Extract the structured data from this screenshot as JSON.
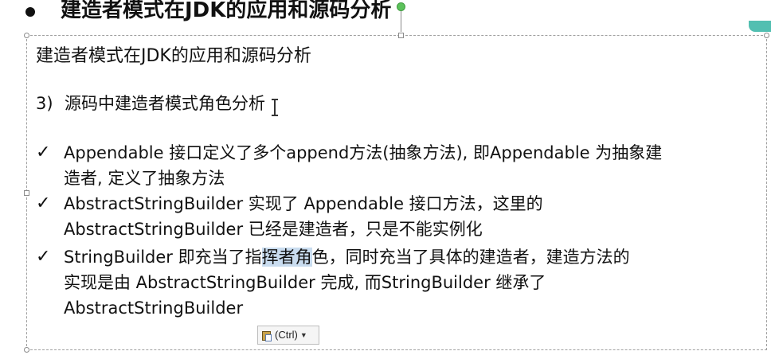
{
  "slide": {
    "title": "建造者模式在JDK的应用和源码分析"
  },
  "textbox": {
    "title": "建造者模式在JDK的应用和源码分析",
    "section_number": "3)",
    "section_title": "源码中建造者模式角色分析",
    "items": [
      {
        "lines": [
          "Appendable 接口定义了多个append方法(抽象方法), 即Appendable 为抽象建",
          "造者, 定义了抽象方法"
        ]
      },
      {
        "lines": [
          "AbstractStringBuilder 实现了 Appendable 接口方法，这里的",
          "AbstractStringBuilder  已经是建造者，只是不能实例化"
        ]
      },
      {
        "line1_before": "StringBuilder 即充当了指",
        "line1_selected": "挥者角",
        "line1_after": "色，同时充当了具体的建造者，建造方法的",
        "lines_rest": [
          "实现是由 AbstractStringBuilder 完成, 而StringBuilder  继承了",
          "AbstractStringBuilder"
        ]
      }
    ],
    "check_glyph": "✓"
  },
  "paste_options": {
    "label": "(Ctrl)",
    "icon": "clipboard-icon"
  },
  "colors": {
    "selection": "#c9dcef",
    "rotate_handle": "#5cc25b"
  }
}
